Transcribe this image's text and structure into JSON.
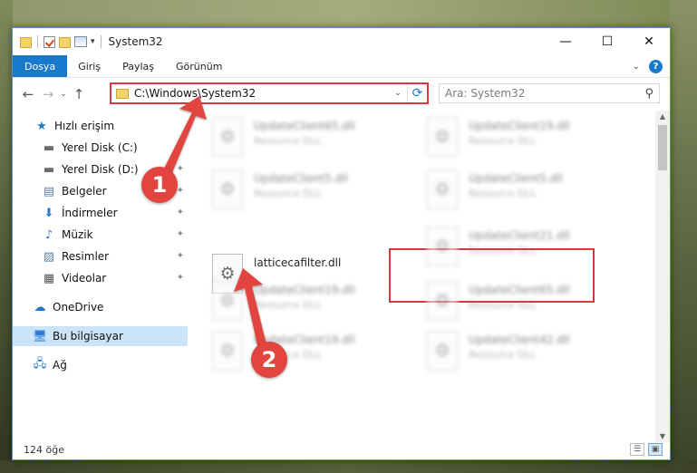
{
  "window": {
    "title": "System32",
    "controls": {
      "minimize": "—",
      "maximize": "☐",
      "close": "✕"
    }
  },
  "ribbon": {
    "tabs": [
      "Dosya",
      "Giriş",
      "Paylaş",
      "Görünüm"
    ],
    "expand_glyph": "⌄",
    "help_glyph": "?"
  },
  "nav": {
    "back": "←",
    "forward": "→",
    "recent": "⌄",
    "up": "↑",
    "address": "C:\\Windows\\System32",
    "address_dropdown": "⌄",
    "refresh": "⟳",
    "search_placeholder": "Ara: System32",
    "search_glyph": "⚲"
  },
  "sidebar": {
    "items": [
      {
        "label": "Hızlı erişim",
        "icon": "star-icon",
        "glyph": "★",
        "color": "#1979ca",
        "pinned": false
      },
      {
        "label": "Yerel Disk (C:)",
        "icon": "drive-icon",
        "glyph": "▬",
        "color": "#6b6b6b",
        "pinned": true
      },
      {
        "label": "Yerel Disk (D:)",
        "icon": "drive-icon",
        "glyph": "▬",
        "color": "#6b6b6b",
        "pinned": true
      },
      {
        "label": "Belgeler",
        "icon": "documents-icon",
        "glyph": "▤",
        "color": "#5d7fa6",
        "pinned": true
      },
      {
        "label": "İndirmeler",
        "icon": "download-icon",
        "glyph": "⬇",
        "color": "#2b7bd6",
        "pinned": true
      },
      {
        "label": "Müzik",
        "icon": "music-icon",
        "glyph": "♪",
        "color": "#2b7bd6",
        "pinned": true
      },
      {
        "label": "Resimler",
        "icon": "pictures-icon",
        "glyph": "▨",
        "color": "#5d7fa6",
        "pinned": true
      },
      {
        "label": "Videolar",
        "icon": "video-icon",
        "glyph": "▦",
        "color": "#555555",
        "pinned": true
      },
      {
        "label": "OneDrive",
        "icon": "cloud-icon",
        "glyph": "☁",
        "color": "#1979ca",
        "pinned": false
      },
      {
        "label": "Bu bilgisayar",
        "icon": "computer-icon",
        "glyph": "🖥",
        "color": "#2b7bd6",
        "pinned": false,
        "selected": true
      },
      {
        "label": "Ağ",
        "icon": "network-icon",
        "glyph": "🖧",
        "color": "#2b7bd6",
        "pinned": false
      }
    ],
    "pin_glyph": "📌"
  },
  "files": [
    {
      "name": "UpdateClient65.dll",
      "type": "Resource DLL",
      "blurred": true
    },
    {
      "name": "UpdateClient19.dll",
      "type": "Resource DLL",
      "blurred": true
    },
    {
      "name": "UpdateClient5.dll",
      "type": "Resource DLL",
      "blurred": true
    },
    {
      "name": "UpdateClient5.dll",
      "type": "Resource DLL",
      "blurred": true
    },
    {
      "name": "latticecafilter.dll",
      "type": "",
      "blurred": false
    },
    {
      "name": "UpdateClient21.dll",
      "type": "Resource DLL",
      "blurred": true
    },
    {
      "name": "UpdateClient19.dll",
      "type": "Resource DLL",
      "blurred": true
    },
    {
      "name": "UpdateClient65.dll",
      "type": "Resource DLL",
      "blurred": true
    },
    {
      "name": "UpdateClient19.dll",
      "type": "Resource DLL",
      "blurred": true
    },
    {
      "name": "UpdateClient42.dll",
      "type": "Resource DLL",
      "blurred": true
    }
  ],
  "status": {
    "count": "124 öğe"
  },
  "annotations": {
    "step1": "1",
    "step2": "2",
    "color": "#e2453f"
  }
}
